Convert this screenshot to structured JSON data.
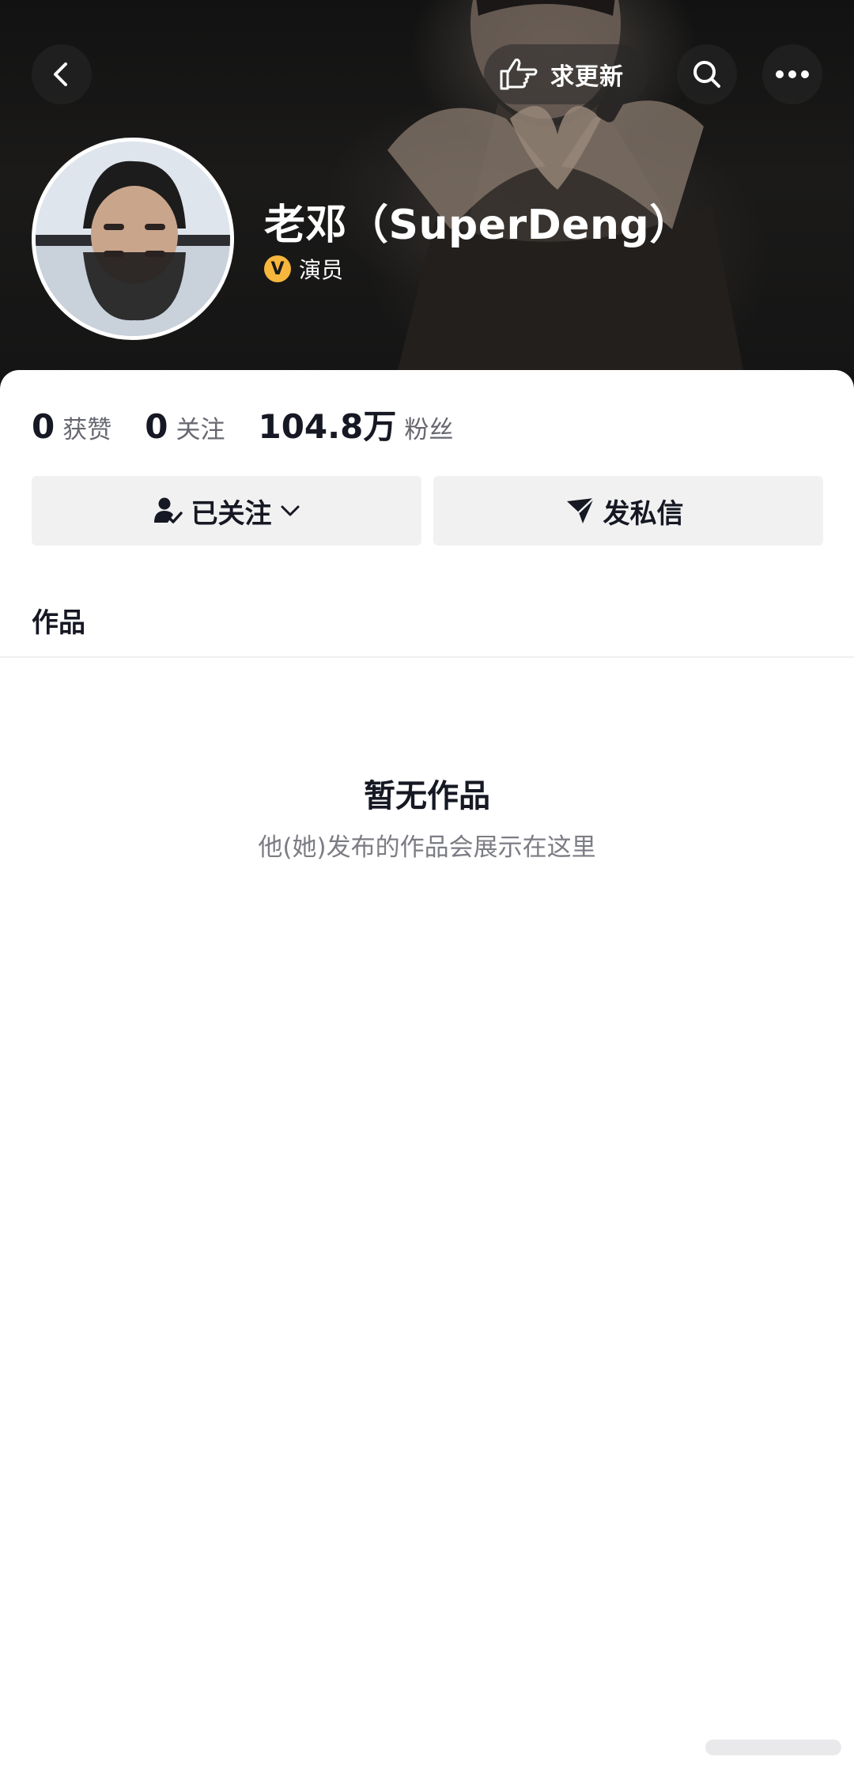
{
  "header": {
    "request_update_label": "求更新",
    "name": "老邓（SuperDeng）",
    "role_badge": "V",
    "role": "演员"
  },
  "stats": {
    "likes": {
      "value": "0",
      "label": "获赞"
    },
    "following": {
      "value": "0",
      "label": "关注"
    },
    "followers": {
      "value": "104.8万",
      "label": "粉丝"
    }
  },
  "actions": {
    "followed_label": "已关注",
    "message_label": "发私信"
  },
  "tabs": {
    "works_label": "作品"
  },
  "empty_state": {
    "title": "暂无作品",
    "subtitle": "他(她)发布的作品会展示在这里"
  },
  "colors": {
    "banner_bg": "#141414",
    "badge": "#f6b73c",
    "button_bg": "#f1f1f2",
    "text_primary": "#161823",
    "text_secondary": "#676870"
  },
  "icons": [
    "back-icon",
    "pointing-hand-icon",
    "search-icon",
    "more-icon",
    "verified-v-icon",
    "followed-user-icon",
    "chevron-down-icon",
    "send-icon"
  ]
}
